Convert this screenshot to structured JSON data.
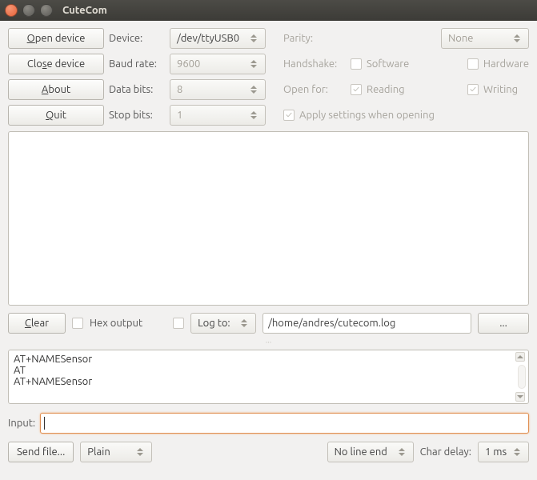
{
  "window": {
    "title": "CuteCom"
  },
  "buttons": {
    "open": "Open device",
    "close": "Close device",
    "about": "About",
    "quit": "Quit",
    "clear": "Clear",
    "browse": "...",
    "sendfile": "Send file..."
  },
  "labels": {
    "device": "Device:",
    "baud": "Baud rate:",
    "databits": "Data bits:",
    "stopbits": "Stop bits:",
    "parity": "Parity:",
    "handshake": "Handshake:",
    "openfor": "Open for:",
    "apply": "Apply settings when opening",
    "hexout": "Hex output",
    "logto": "Log to:",
    "input": "Input:",
    "chardelay": "Char delay:"
  },
  "checkboxes": {
    "software": "Software",
    "hardware": "Hardware",
    "reading": "Reading",
    "writing": "Writing"
  },
  "values": {
    "device": "/dev/ttyUSB0",
    "baud": "9600",
    "databits": "8",
    "stopbits": "1",
    "parity": "None",
    "logfile": "/home/andres/cutecom.log",
    "encoding": "Plain",
    "lineend": "No line end",
    "chardelay": "1 ms"
  },
  "history": [
    "AT+NAMESensor",
    "AT",
    "AT+NAMESensor"
  ]
}
